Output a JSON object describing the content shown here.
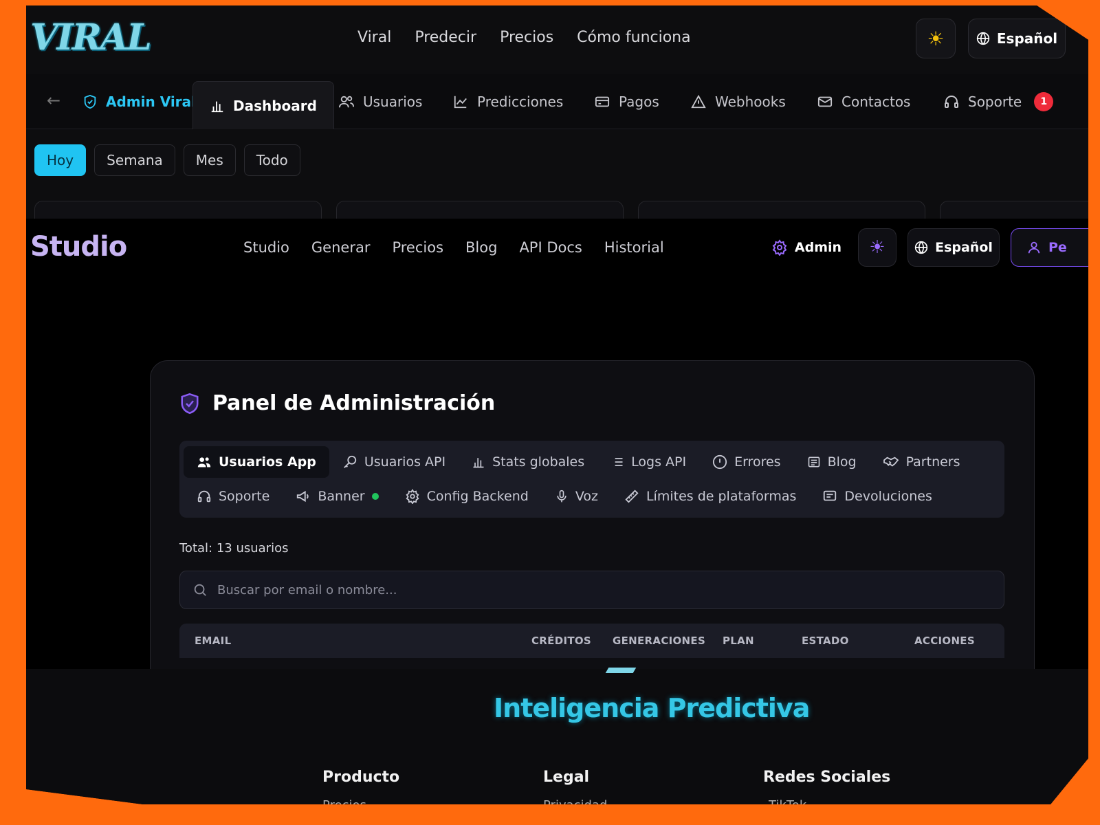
{
  "viral": {
    "logo": "VIRAL",
    "nav": [
      "Viral",
      "Predecir",
      "Precios",
      "Cómo funciona"
    ],
    "language": "Español",
    "admin_bar": {
      "brand": "Admin Viral",
      "items": [
        {
          "label": "Dashboard",
          "icon": "bar-chart-icon"
        },
        {
          "label": "Usuarios",
          "icon": "users-icon"
        },
        {
          "label": "Predicciones",
          "icon": "line-chart-icon"
        },
        {
          "label": "Pagos",
          "icon": "credit-card-icon"
        },
        {
          "label": "Webhooks",
          "icon": "warning-icon"
        },
        {
          "label": "Contactos",
          "icon": "mail-icon"
        },
        {
          "label": "Soporte",
          "icon": "headset-icon"
        }
      ],
      "support_badge": "1"
    },
    "filters": [
      "Hoy",
      "Semana",
      "Mes",
      "Todo"
    ],
    "active_filter": "Hoy"
  },
  "studio": {
    "logo": "Studio",
    "nav": [
      "Studio",
      "Generar",
      "Precios",
      "Blog",
      "API Docs",
      "Historial"
    ],
    "admin_label": "Admin",
    "language": "Español",
    "profile_label": "Pe",
    "panel": {
      "title": "Panel de Administración",
      "tabs_row1": [
        {
          "label": "Usuarios App",
          "icon": "users-icon"
        },
        {
          "label": "Usuarios API",
          "icon": "key-icon"
        },
        {
          "label": "Stats globales",
          "icon": "bar-chart-icon"
        },
        {
          "label": "Logs API",
          "icon": "list-icon"
        },
        {
          "label": "Errores",
          "icon": "alert-circle-icon"
        },
        {
          "label": "Blog",
          "icon": "newspaper-icon"
        },
        {
          "label": "Partners",
          "icon": "handshake-icon"
        }
      ],
      "tabs_row2": [
        {
          "label": "Soporte",
          "icon": "headset-icon"
        },
        {
          "label": "Banner",
          "icon": "megaphone-icon"
        },
        {
          "label": "Config Backend",
          "icon": "gear-icon"
        },
        {
          "label": "Voz",
          "icon": "microphone-icon"
        },
        {
          "label": "Límites de plataformas",
          "icon": "ruler-icon"
        },
        {
          "label": "Devoluciones",
          "icon": "message-square-icon"
        }
      ],
      "total": "Total: 13 usuarios",
      "search_placeholder": "Buscar por email o nombre...",
      "columns": [
        "EMAIL",
        "CRÉDITOS",
        "GENERACIONES",
        "PLAN",
        "ESTADO",
        "ACCIONES"
      ]
    }
  },
  "footer": {
    "tagline": "Inteligencia Predictiva",
    "columns": [
      "Producto",
      "Legal",
      "Redes Sociales"
    ],
    "partial_links": [
      "Precios",
      "Privacidad",
      "TikTok"
    ]
  },
  "colors": {
    "frame": "#ff6a0d",
    "viral_accent": "#20c4f2",
    "studio_accent": "#9a6bff",
    "badge": "#ef2b3a",
    "status_dot": "#21c55d"
  }
}
